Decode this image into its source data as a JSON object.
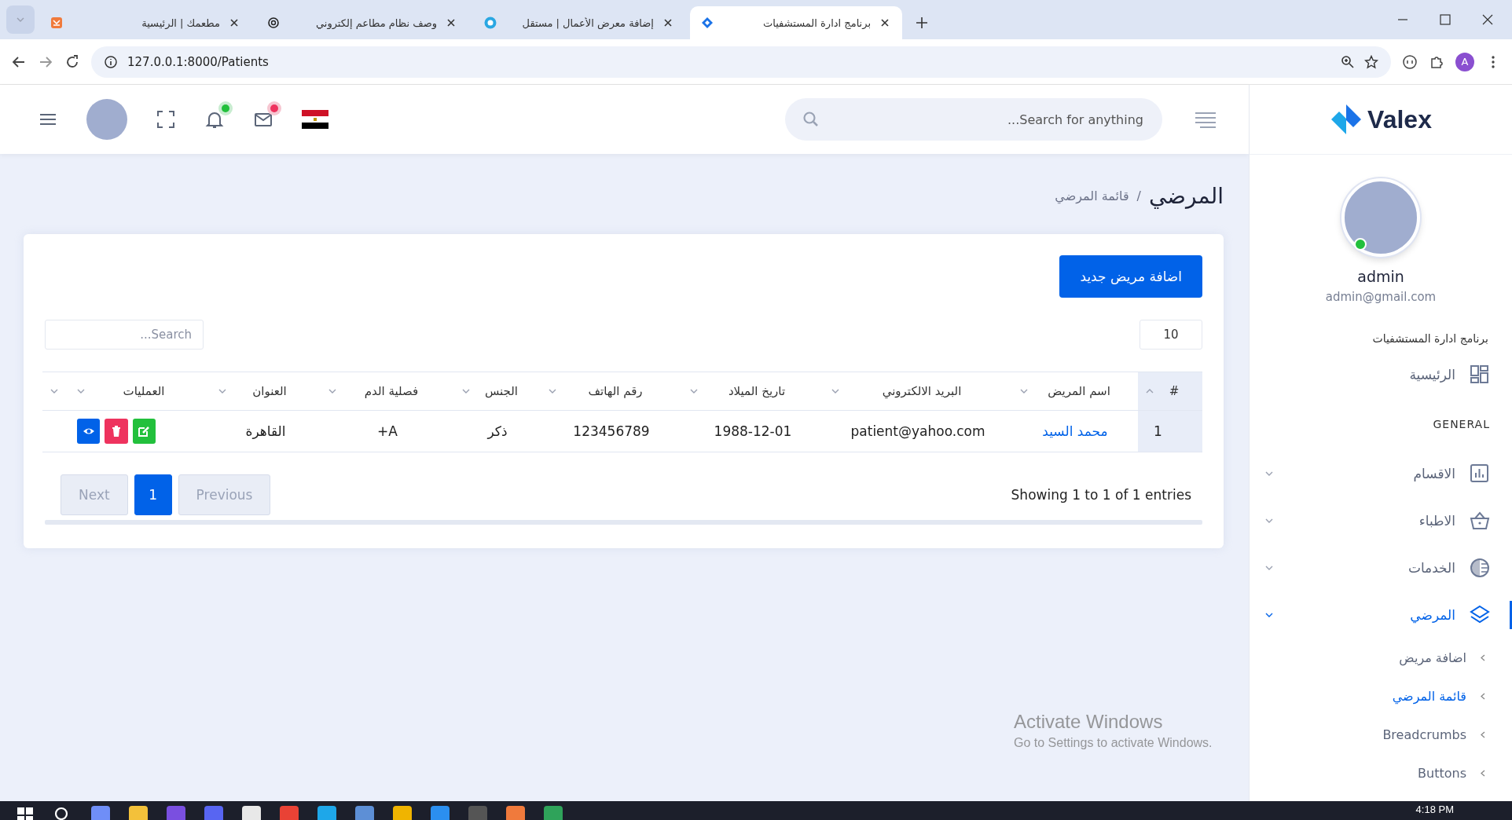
{
  "browser": {
    "tabs": [
      {
        "title": "برنامج ادارة المستشفيات",
        "selected": true
      },
      {
        "title": "إضافة معرض الأعمال | مستقل",
        "selected": false
      },
      {
        "title": "وصف نظام مطاعم إلكتروني",
        "selected": false
      },
      {
        "title": "مطعمك | الرئيسية",
        "selected": false
      }
    ],
    "url": "127.0.0.1:8000/Patients",
    "profile_initial": "A"
  },
  "header": {
    "search_placeholder": "Search for anything..."
  },
  "sidebar": {
    "logo": "Valex",
    "user": {
      "name": "admin",
      "email": "admin@gmail.com",
      "online": true
    },
    "app_title": "برنامج ادارة المستشفيات",
    "items": [
      {
        "kind": "link",
        "label": "الرئيسية",
        "selected": false
      },
      {
        "kind": "heading",
        "label": "GENERAL"
      },
      {
        "kind": "menu",
        "label": "الاقسام",
        "selected": false
      },
      {
        "kind": "menu",
        "label": "الاطباء",
        "selected": false
      },
      {
        "kind": "menu",
        "label": "الخدمات",
        "selected": false
      },
      {
        "kind": "menu",
        "label": "المرضي",
        "expanded": true,
        "selected": true,
        "children": [
          {
            "label": "اضافة مريض",
            "selected": false
          },
          {
            "label": "قائمة المرضي",
            "selected": true
          },
          {
            "label": "Breadcrumbs",
            "selected": false
          },
          {
            "label": "Buttons",
            "selected": false
          }
        ]
      }
    ]
  },
  "page": {
    "title": "المرضي",
    "breadcrumb_separator": "/",
    "breadcrumb": "قائمة المرضي"
  },
  "card": {
    "add_button": "اضافة مريض جديد",
    "page_length": "10",
    "search_placeholder": "Search...",
    "table": {
      "columns": [
        {
          "label": "#",
          "sorted": true
        },
        {
          "label": "اسم المريض",
          "sorted": false
        },
        {
          "label": "البريد الالكتروني",
          "sorted": false
        },
        {
          "label": "تاريخ الميلاد",
          "sorted": false
        },
        {
          "label": "رقم الهاتف",
          "sorted": false
        },
        {
          "label": "الجنس",
          "sorted": false
        },
        {
          "label": "فصلية الدم",
          "sorted": false
        },
        {
          "label": "العنوان",
          "sorted": false
        },
        {
          "label": "العمليات",
          "sorted": false
        },
        {
          "sorted": false
        }
      ],
      "rows": [
        {
          "cells": [
            "1",
            "محمد السيد",
            "patient@yahoo.com",
            "1988-12-01",
            "123456789",
            "ذكر",
            "A+",
            "القاهرة"
          ],
          "actions": [
            {
              "kind": "edit"
            },
            {
              "kind": "delete"
            },
            {
              "kind": "view"
            }
          ]
        }
      ]
    },
    "info": "Showing 1 to 1 of 1 entries",
    "pagination": [
      {
        "label": "Previous",
        "selected": false,
        "disabled": true
      },
      {
        "label": "1",
        "selected": true,
        "disabled": false
      },
      {
        "label": "Next",
        "selected": false,
        "disabled": true
      }
    ]
  },
  "windows_notice": {
    "title": "Activate Windows",
    "text": "Go to Settings to activate Windows."
  },
  "taskbar": {
    "time": "4:18 PM"
  }
}
